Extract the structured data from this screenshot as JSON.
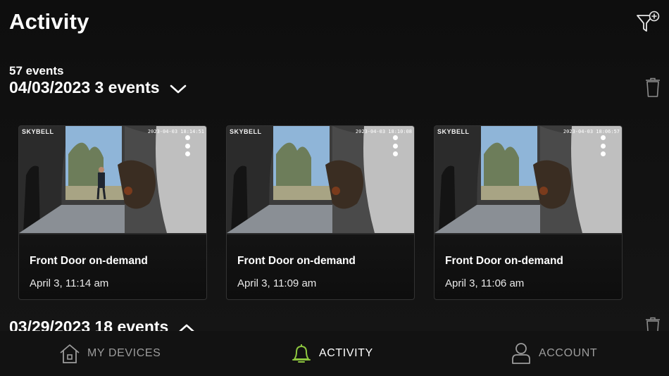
{
  "header": {
    "title": "Activity"
  },
  "summary": {
    "total_events": "57 events"
  },
  "groups": [
    {
      "label": "04/03/2023 3 events",
      "state": "expanded"
    },
    {
      "label": "03/29/2023 18 events",
      "state": "collapsed"
    }
  ],
  "events": [
    {
      "brand": "SKYBELL",
      "stamp": "2023-04-03 18:14:51",
      "title": "Front Door on-demand",
      "time": "April 3, 11:14 am",
      "has_person": true
    },
    {
      "brand": "SKYBELL",
      "stamp": "2023-04-03 18:10:08",
      "title": "Front Door on-demand",
      "time": "April 3, 11:09 am",
      "has_person": false
    },
    {
      "brand": "SKYBELL",
      "stamp": "2023-04-03 18:06:57",
      "title": "Front Door on-demand",
      "time": "April 3, 11:06 am",
      "has_person": false
    }
  ],
  "tabs": [
    {
      "label": "MY DEVICES",
      "icon": "house-icon",
      "active": false
    },
    {
      "label": "ACTIVITY",
      "icon": "bell-icon",
      "active": true
    },
    {
      "label": "ACCOUNT",
      "icon": "person-icon",
      "active": false
    }
  ],
  "colors": {
    "accent": "#8dc63f",
    "background": "#111111",
    "inactive": "#9c9c9c"
  }
}
